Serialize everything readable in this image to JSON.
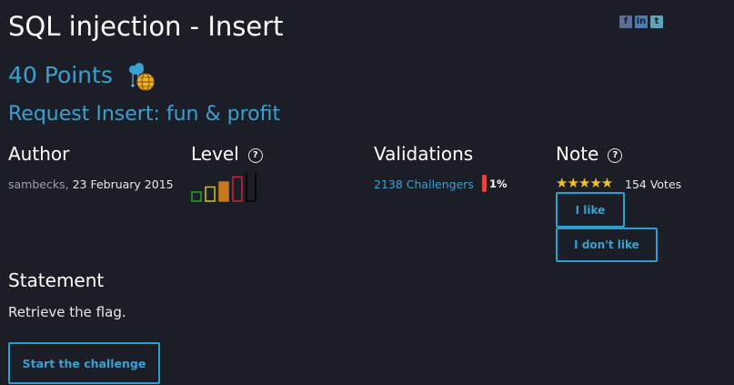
{
  "header": {
    "title": "SQL injection - Insert",
    "points": "40 Points",
    "subtitle": "Request Insert: fun & profit"
  },
  "social": {
    "icons": [
      "facebook-icon",
      "linkedin-icon",
      "twitter-icon"
    ]
  },
  "author": {
    "heading": "Author",
    "name": "sambecks",
    "separator": ", ",
    "date": "23 February 2015"
  },
  "level": {
    "heading": "Level",
    "help": "?",
    "selected": 4,
    "total": 5
  },
  "validations": {
    "heading": "Validations",
    "challengers": "2138 Challengers",
    "percent": "1%"
  },
  "note": {
    "heading": "Note",
    "help": "?",
    "stars": "★★★★★",
    "votes": "154 Votes",
    "like_label": "I like",
    "dislike_label": "I don't like"
  },
  "statement": {
    "heading": "Statement",
    "text": "Retrieve the flag."
  },
  "start_label": "Start the challenge",
  "colors": {
    "accent": "#3aa0cf",
    "background": "#1b1e27",
    "star": "#f2c21b",
    "level": [
      "#2ea12e",
      "#d6c318",
      "#c9781b",
      "#cc2a2a",
      "#111111"
    ]
  }
}
